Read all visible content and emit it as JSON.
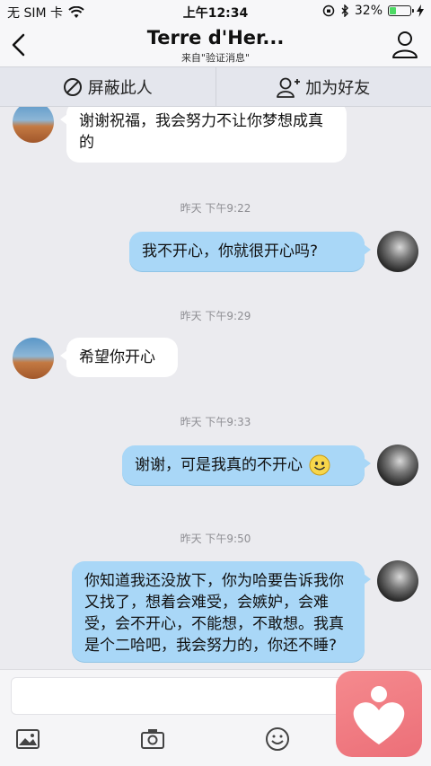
{
  "status_bar": {
    "carrier": "无 SIM 卡",
    "time": "上午12:34",
    "battery_percent": "32%",
    "battery_level": 0.32
  },
  "nav": {
    "title": "Terre d'Her...",
    "subtitle": "来自\"验证消息\""
  },
  "actions": {
    "block_label": "屏蔽此人",
    "add_friend_label": "加为好友"
  },
  "messages": [
    {
      "from": "friend",
      "text": "谢谢祝福，我会努力不让你梦想成真的"
    },
    {
      "timestamp": "昨天 下午9:22"
    },
    {
      "from": "me",
      "text": "我不开心，你就很开心吗?"
    },
    {
      "timestamp": "昨天 下午9:29"
    },
    {
      "from": "friend",
      "text": "希望你开心"
    },
    {
      "timestamp": "昨天 下午9:33"
    },
    {
      "from": "me",
      "text": "谢谢，可是我真的不开心",
      "emoji": "smile-emoji"
    },
    {
      "timestamp": "昨天 下午9:50"
    },
    {
      "from": "me",
      "text": "你知道我还没放下，你为哈要告诉我你又找了，想着会难受，会嫉妒，会难受，会不开心，不能想，不敢想。我真是个二哈吧，我会努力的，你还不睡?"
    }
  ],
  "input": {
    "placeholder": "",
    "tools": [
      "image-icon",
      "camera-icon",
      "emoji-icon"
    ]
  },
  "colors": {
    "outgoing_bubble": "#a9d7f7",
    "incoming_bubble": "#ffffff",
    "background": "#ebebef",
    "overlay_app": "#ec6f78"
  }
}
